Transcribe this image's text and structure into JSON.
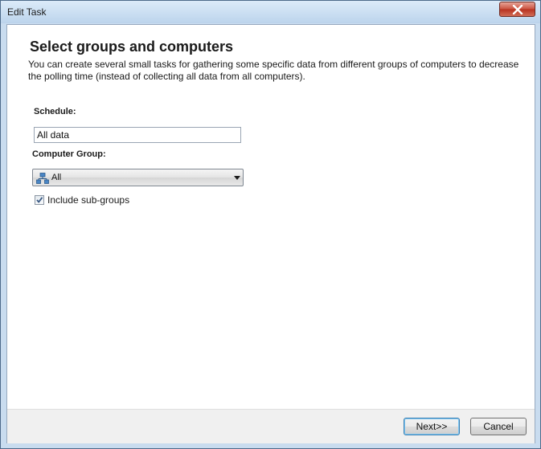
{
  "window": {
    "title": "Edit Task",
    "close_icon": "close-icon"
  },
  "page": {
    "heading": "Select groups and computers",
    "description": "You can create several small tasks for gathering some specific data from different groups of computers to decrease the polling time (instead of collecting all data from all computers)."
  },
  "form": {
    "schedule_label": "Schedule:",
    "schedule_value": "All data",
    "group_label": "Computer Group:",
    "group_value": "All",
    "group_icon": "network-group-icon",
    "include_subgroups_label": "Include sub-groups",
    "include_subgroups_checked": true
  },
  "buttons": {
    "next": "Next>>",
    "cancel": "Cancel"
  },
  "colors": {
    "accent": "#3c7fb1",
    "close": "#c9503d"
  }
}
